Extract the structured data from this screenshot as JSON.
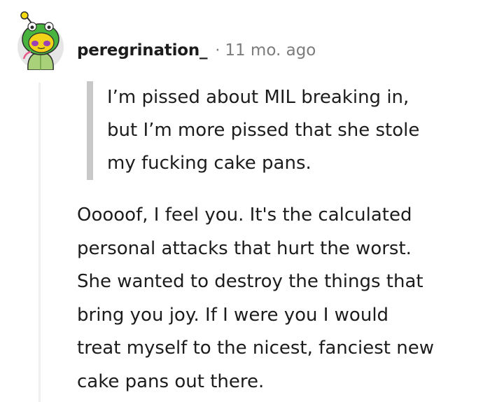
{
  "comment": {
    "username": "peregrination_",
    "separator": "·",
    "timestamp": "11 mo. ago",
    "avatar_icon": "snoo-avatar-icon",
    "quote_lines": [
      "I’m pissed about MIL breaking in,",
      "but I’m more pissed that she stole",
      "my fucking cake pans."
    ],
    "body_lines": [
      "Ooooof, I feel you. It's the calculated",
      "personal attacks that hurt the worst.",
      "She wanted to destroy the things that",
      "bring you joy. If I were you I would",
      "treat myself to the nicest, fanciest new",
      "cake pans out there."
    ]
  },
  "colors": {
    "text": "#1c1c1c",
    "meta": "#7c7c7c",
    "quote_bar": "#c8c8c8",
    "thread_line": "#edeff1"
  }
}
